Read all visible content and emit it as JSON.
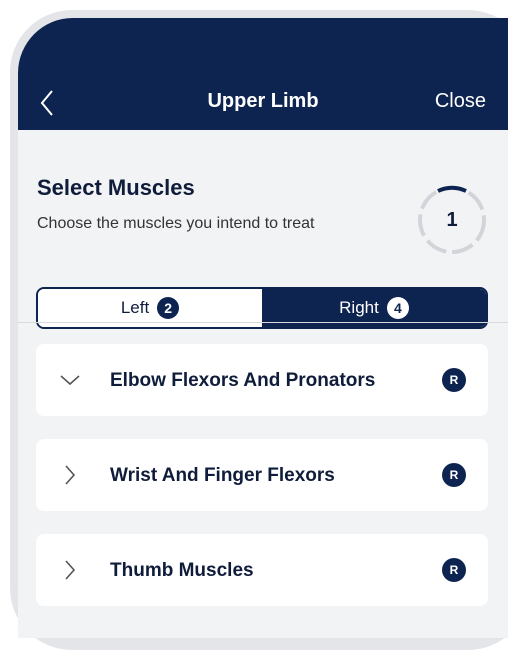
{
  "header": {
    "back_icon": "chevron-left-icon",
    "title": "Upper Limb",
    "close_label": "Close"
  },
  "select": {
    "title": "Select Muscles",
    "subtitle": "Choose the muscles you intend to treat",
    "step": "1"
  },
  "segments": {
    "left": {
      "label": "Left",
      "count": "2",
      "selected": false
    },
    "right": {
      "label": "Right",
      "count": "4",
      "selected": true
    }
  },
  "muscle_groups": [
    {
      "label": "Elbow Flexors And Pronators",
      "expanded": true,
      "badge": "R"
    },
    {
      "label": "Wrist And Finger Flexors",
      "expanded": false,
      "badge": "R"
    },
    {
      "label": "Thumb Muscles",
      "expanded": false,
      "badge": "R"
    }
  ],
  "colors": {
    "primary": "#0e2450",
    "background": "#f2f3f5",
    "card": "#ffffff",
    "text": "#0f1c3a"
  }
}
